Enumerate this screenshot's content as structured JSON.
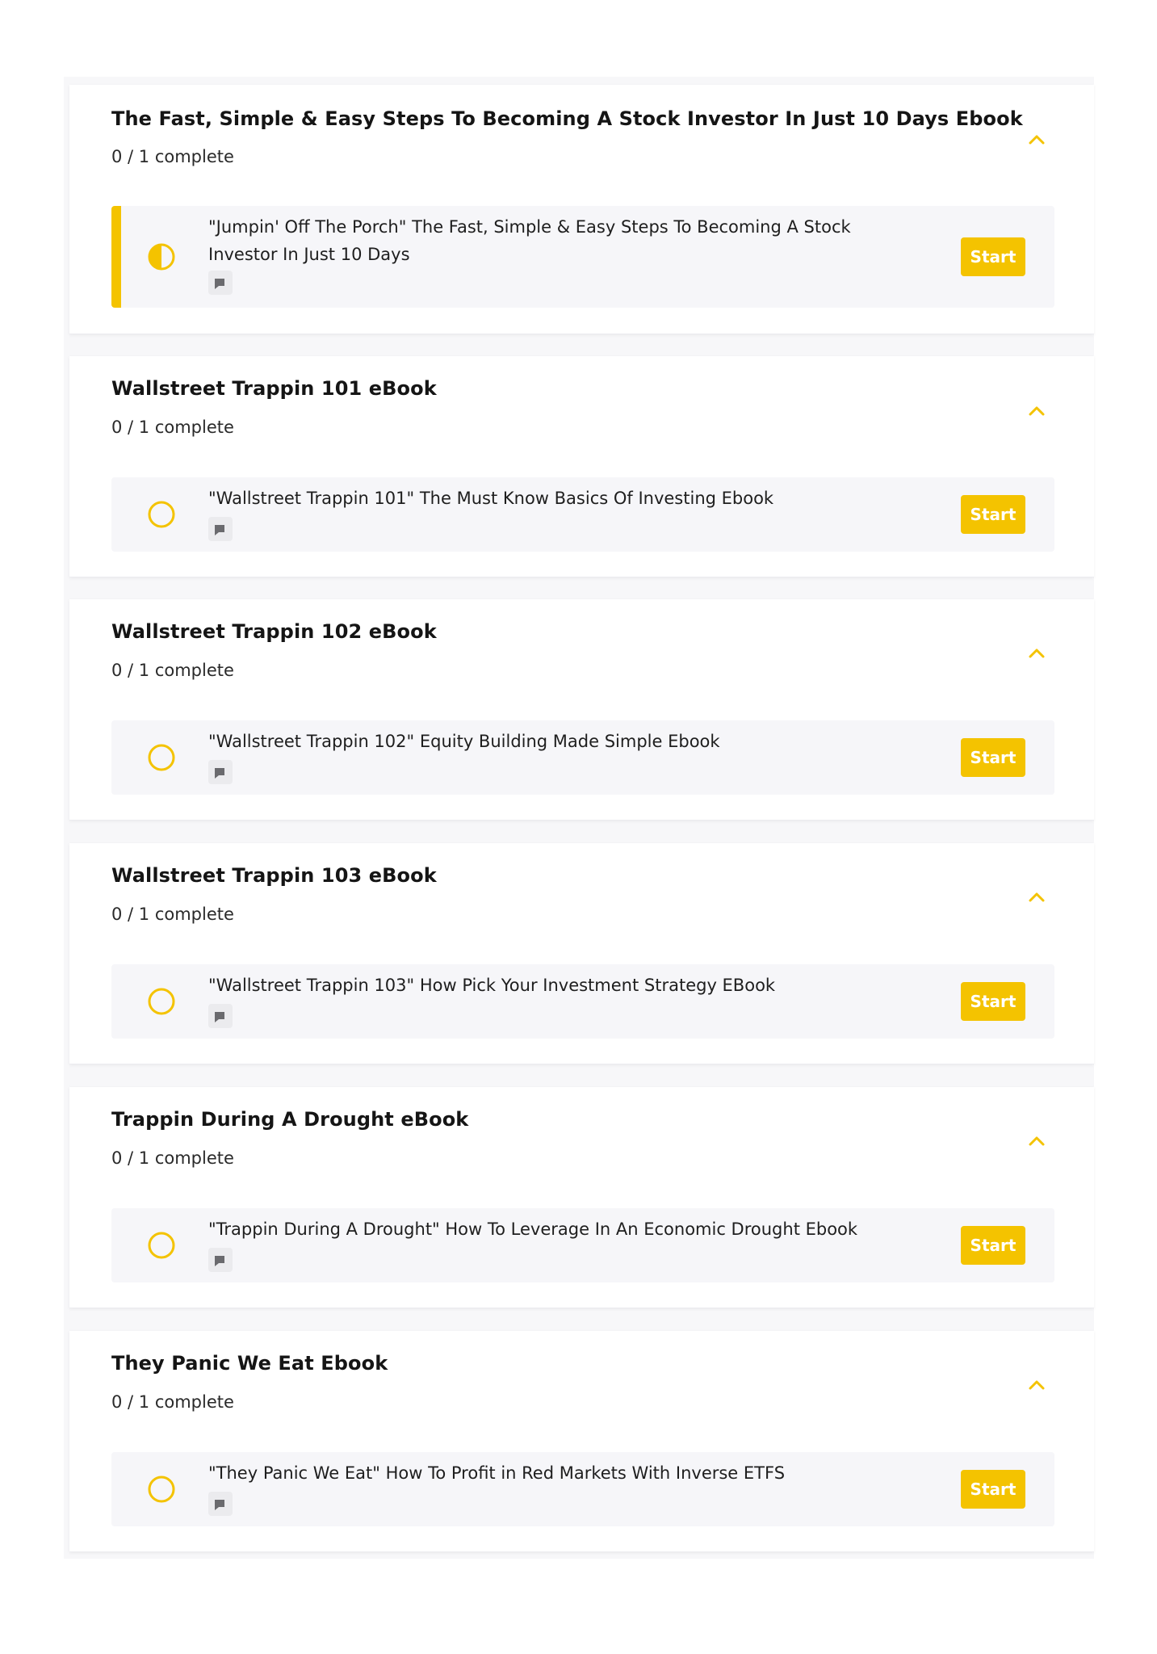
{
  "colors": {
    "accent": "#f4c300",
    "row_background": "#f6f6f9",
    "page_background": "#f7f7f9"
  },
  "sections": [
    {
      "title": "The Fast, Simple & Easy Steps To Becoming A Stock Investor In Just 10 Days Ebook",
      "progress": "0 / 1 complete",
      "expanded_icon": "chevron-up-icon",
      "lesson": {
        "title": "\"Jumpin' Off The Porch\" The Fast, Simple & Easy Steps To Becoming A Stock Investor In Just 10 Days",
        "status_icon": "half-circle-icon",
        "type_icon": "document-icon",
        "action_label": "Start"
      }
    },
    {
      "title": "Wallstreet Trappin 101 eBook",
      "progress": "0 / 1 complete",
      "expanded_icon": "chevron-up-icon",
      "lesson": {
        "title": "\"Wallstreet Trappin 101\" The Must Know Basics Of Investing Ebook",
        "status_icon": "empty-circle-icon",
        "type_icon": "document-icon",
        "action_label": "Start"
      }
    },
    {
      "title": "Wallstreet Trappin 102 eBook",
      "progress": "0 / 1 complete",
      "expanded_icon": "chevron-up-icon",
      "lesson": {
        "title": "\"Wallstreet Trappin 102\" Equity Building Made Simple Ebook",
        "status_icon": "empty-circle-icon",
        "type_icon": "document-icon",
        "action_label": "Start"
      }
    },
    {
      "title": "Wallstreet Trappin 103 eBook",
      "progress": "0 / 1 complete",
      "expanded_icon": "chevron-up-icon",
      "lesson": {
        "title": "\"Wallstreet Trappin 103\" How Pick Your Investment Strategy EBook",
        "status_icon": "empty-circle-icon",
        "type_icon": "document-icon",
        "action_label": "Start"
      }
    },
    {
      "title": "Trappin During A Drought eBook",
      "progress": "0 / 1 complete",
      "expanded_icon": "chevron-up-icon",
      "lesson": {
        "title": "\"Trappin During A Drought\" How To Leverage In An Economic Drought Ebook",
        "status_icon": "empty-circle-icon",
        "type_icon": "document-icon",
        "action_label": "Start"
      }
    },
    {
      "title": "They Panic We Eat Ebook",
      "progress": "0 / 1 complete",
      "expanded_icon": "chevron-up-icon",
      "lesson": {
        "title": "\"They Panic We Eat\" How To Profit in Red Markets With Inverse ETFS",
        "status_icon": "empty-circle-icon",
        "type_icon": "document-icon",
        "action_label": "Start"
      }
    }
  ]
}
